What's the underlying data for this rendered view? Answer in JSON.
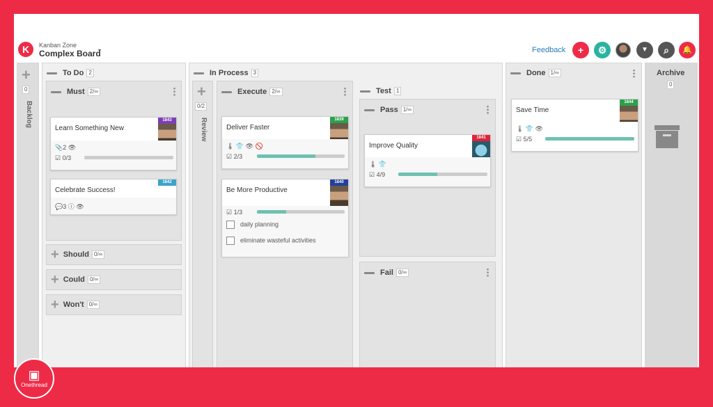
{
  "app": {
    "brand_sub": "Kanban Zone",
    "board_title": "Complex Board",
    "logo_letter": "K",
    "caret": "▾"
  },
  "toolbar": {
    "feedback": "Feedback",
    "add_icon": "+",
    "settings_icon": "⚙",
    "filter_icon": "▼",
    "search_icon": "⌕",
    "bell_icon": "🔔"
  },
  "columns": {
    "backlog": {
      "label": "Backlog",
      "count": "0",
      "add": "+"
    },
    "todo": {
      "label": "To Do",
      "count": "2"
    },
    "must": {
      "label": "Must",
      "limit": "2/∞"
    },
    "should": {
      "label": "Should",
      "limit": "0/∞"
    },
    "could": {
      "label": "Could",
      "limit": "0/∞"
    },
    "wont": {
      "label": "Won't",
      "limit": "0/∞"
    },
    "inprocess": {
      "label": "In Process",
      "count": "3"
    },
    "review": {
      "label": "Review",
      "count": "0/2",
      "add": "+"
    },
    "execute": {
      "label": "Execute",
      "limit": "2/∞"
    },
    "test": {
      "label": "Test",
      "count": "1"
    },
    "pass": {
      "label": "Pass",
      "limit": "1/∞"
    },
    "fail": {
      "label": "Fail",
      "limit": "0/∞"
    },
    "done": {
      "label": "Done",
      "limit": "1/∞"
    },
    "archive": {
      "label": "Archive",
      "count": "0"
    }
  },
  "cards": {
    "c1843": {
      "id": "1843",
      "title": "Learn Something New",
      "icons": "📎2 👁",
      "progress": "☑ 0/3",
      "progress_value": 0,
      "id_color": "#7b3fb5"
    },
    "c1842": {
      "id": "1842",
      "title": "Celebrate Success!",
      "icons": "💬3 ⓘ 👁",
      "id_color": "#3aa3c9"
    },
    "c1839": {
      "id": "1839",
      "title": "Deliver Faster",
      "icons": "🌡 👕 👁 🚫",
      "progress": "☑ 2/3",
      "progress_value": 0.67,
      "id_color": "#2ba14b"
    },
    "c1840": {
      "id": "1840",
      "title": "Be More Productive",
      "progress": "☑ 1/3",
      "progress_value": 0.33,
      "id_color": "#23409a",
      "checklist": [
        "daily planning",
        "eliminate wasteful activities"
      ]
    },
    "c1841": {
      "id": "1841",
      "title": "Improve Quality",
      "icons": "🌡 👕",
      "progress": "☑ 4/9",
      "progress_value": 0.44,
      "id_color": "#e0233c"
    },
    "c1844": {
      "id": "1844",
      "title": "Save Time",
      "icons": "🌡 👕 👁",
      "progress": "☑ 5/5",
      "progress_value": 1.0,
      "id_color": "#2ba14b"
    }
  },
  "watermark": {
    "label": "Onethread",
    "mark": "▣"
  },
  "colors": {
    "frame": "#ee2b47",
    "accent": "#6fc1b0",
    "link": "#2a7ab8"
  }
}
